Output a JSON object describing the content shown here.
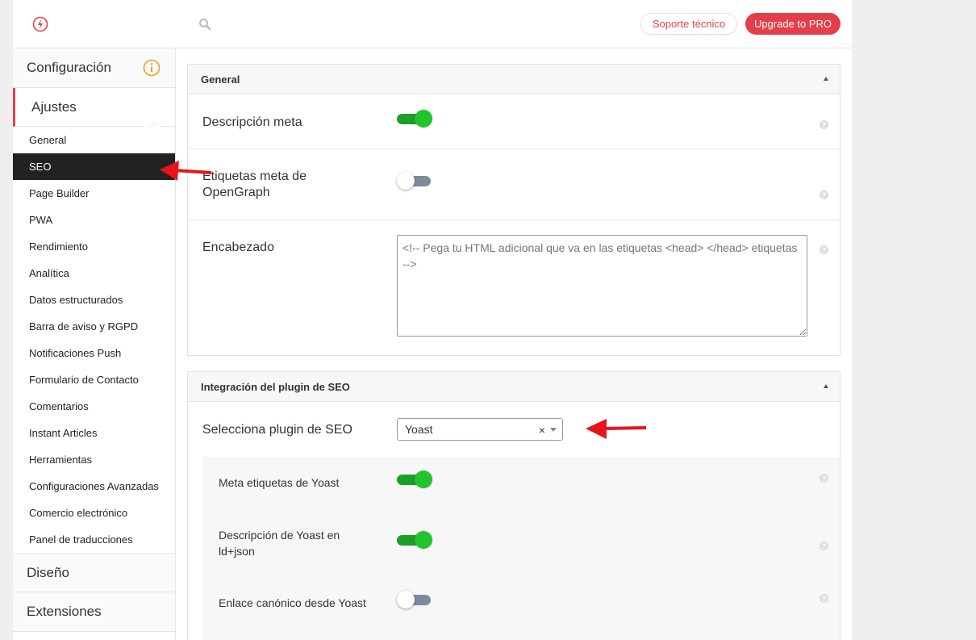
{
  "topbar": {
    "logo_icon": "bolt-circle-icon",
    "search_icon": "search-icon",
    "support_label": "Soporte técnico",
    "upgrade_label": "Upgrade to PRO"
  },
  "sidebar": {
    "config_title": "Configuración",
    "active_section": "Ajustes",
    "items": [
      "General",
      "SEO",
      "Page Builder",
      "PWA",
      "Rendimiento",
      "Analítica",
      "Datos estructurados",
      "Barra de aviso y RGPD",
      "Notificaciones Push",
      "Formulario de Contacto",
      "Comentarios",
      "Instant Articles",
      "Herramientas",
      "Configuraciones Avanzadas",
      "Comercio electrónico",
      "Panel de traducciones"
    ],
    "selected_item": "SEO",
    "design_section": "Diseño",
    "extensions_section": "Extensiones"
  },
  "general_card": {
    "title": "General",
    "meta_description_label": "Descripción meta",
    "meta_description_on": true,
    "opengraph_label_1": "Etiquetas meta de",
    "opengraph_label_2": "OpenGraph",
    "opengraph_on": false,
    "header_label": "Encabezado",
    "header_placeholder": "<!-- Pega tu HTML adicional que va en las etiquetas <head> </head> etiquetas -->"
  },
  "seo_card": {
    "title": "Integración del plugin de SEO",
    "select_label": "Selecciona plugin de SEO",
    "select_value": "Yoast",
    "clear_glyph": "×",
    "yoast_meta_label": "Meta etiquetas de Yoast",
    "yoast_meta_on": true,
    "yoast_desc_label_1": "Descripción de Yoast en",
    "yoast_desc_label_2": "ld+json",
    "yoast_desc_on": true,
    "yoast_canonical_label": "Enlace canónico desde Yoast",
    "yoast_canonical_on": false
  },
  "help_glyph": "?",
  "colors": {
    "accent_red": "#e63e48",
    "toggle_on": "#21c32e",
    "toggle_off": "#7d8a9c",
    "annotation_arrow": "#e8141c"
  }
}
